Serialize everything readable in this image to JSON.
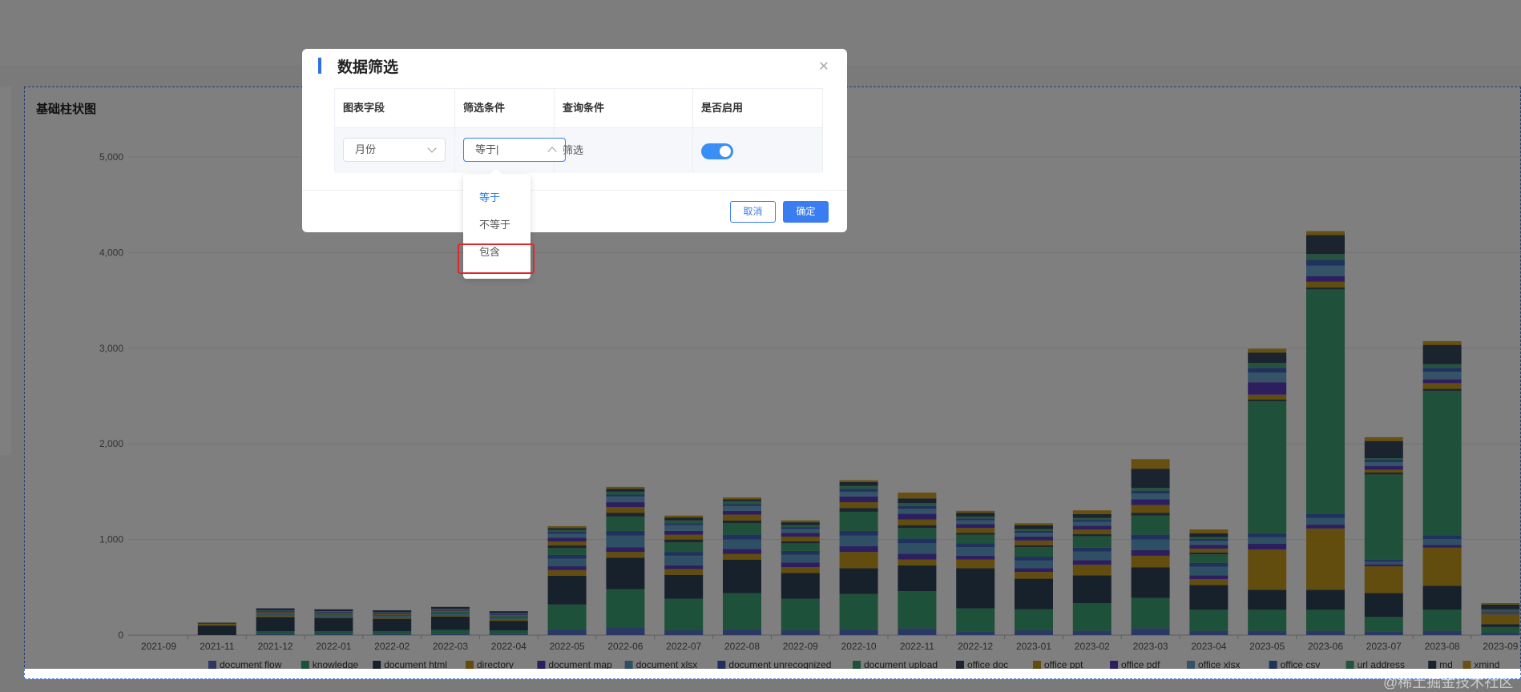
{
  "card": {
    "title": "基础柱状图"
  },
  "modal": {
    "title": "数据筛选",
    "headers": [
      "图表字段",
      "筛选条件",
      "查询条件",
      "是否启用"
    ],
    "row": {
      "field": "月份",
      "condition": "等于|",
      "query": "筛选",
      "enabled": true
    },
    "cancel_label": "取消",
    "ok_label": "确定"
  },
  "dropdown": {
    "options": [
      "等于",
      "不等于",
      "包含"
    ],
    "selected": "等于"
  },
  "watermark": "@稀土掘金技术社区",
  "colors": {
    "document_flow": "#5470c6",
    "knowledge": "#3ba272",
    "document_html": "#2f4258",
    "directory": "#c49a1f",
    "document_map": "#5b3fbf",
    "document_xlsx": "#5f9fc9",
    "document_unrecognized": "#3e63b8",
    "document_upload": "#3fa073",
    "office_doc": "#3b4a5e",
    "office_ppt": "#c49a1f",
    "office_pdf": "#5b3fbf",
    "office_xlsx": "#6aa6cf",
    "office_csv": "#3e63b8",
    "url_address": "#4aa67f",
    "md": "#34475c",
    "xmind": "#d0a020"
  },
  "chart_data": {
    "type": "bar",
    "stacked": true,
    "ylim": [
      0,
      5000
    ],
    "yticks": [
      "0",
      "1,000",
      "2,000",
      "3,000",
      "4,000",
      "5,000"
    ],
    "categories": [
      "2021-09",
      "2021-11",
      "2021-12",
      "2022-01",
      "2022-02",
      "2022-03",
      "2022-04",
      "2022-05",
      "2022-06",
      "2022-07",
      "2022-08",
      "2022-09",
      "2022-10",
      "2022-11",
      "2022-12",
      "2023-01",
      "2023-02",
      "2023-03",
      "2023-04",
      "2023-05",
      "2023-06",
      "2023-07",
      "2023-08",
      "2023-09"
    ],
    "series": [
      {
        "name": "document_flow",
        "values": [
          0,
          0,
          10,
          10,
          10,
          15,
          10,
          60,
          80,
          50,
          60,
          50,
          60,
          70,
          40,
          50,
          45,
          70,
          45,
          45,
          45,
          40,
          45,
          25
        ]
      },
      {
        "name": "knowledge",
        "values": [
          0,
          0,
          30,
          30,
          30,
          40,
          40,
          260,
          400,
          330,
          380,
          330,
          370,
          390,
          240,
          220,
          290,
          320,
          220,
          220,
          220,
          150,
          220,
          60
        ]
      },
      {
        "name": "document_html",
        "values": [
          0,
          100,
          150,
          140,
          130,
          140,
          100,
          300,
          330,
          250,
          350,
          270,
          270,
          270,
          420,
          320,
          290,
          320,
          260,
          210,
          210,
          250,
          250,
          30
        ]
      },
      {
        "name": "directory",
        "values": [
          0,
          10,
          10,
          10,
          10,
          10,
          10,
          60,
          60,
          60,
          60,
          60,
          170,
          60,
          90,
          70,
          110,
          120,
          60,
          420,
          640,
          280,
          400,
          100
        ]
      },
      {
        "name": "document_map",
        "values": [
          0,
          0,
          0,
          0,
          0,
          0,
          0,
          40,
          50,
          40,
          50,
          50,
          60,
          60,
          40,
          40,
          50,
          60,
          40,
          60,
          40,
          20,
          30,
          5
        ]
      },
      {
        "name": "document_xlsx",
        "values": [
          0,
          0,
          20,
          20,
          20,
          20,
          20,
          80,
          120,
          100,
          100,
          80,
          110,
          110,
          90,
          80,
          90,
          110,
          90,
          70,
          70,
          30,
          60,
          5
        ]
      },
      {
        "name": "document_unrecognized",
        "values": [
          0,
          0,
          0,
          0,
          0,
          0,
          0,
          40,
          50,
          40,
          50,
          40,
          50,
          50,
          40,
          40,
          40,
          50,
          40,
          40,
          40,
          20,
          40,
          5
        ]
      },
      {
        "name": "document_upload",
        "values": [
          0,
          0,
          10,
          10,
          10,
          20,
          20,
          70,
          150,
          100,
          120,
          80,
          200,
          110,
          90,
          100,
          120,
          200,
          90,
          1380,
          2350,
          890,
          1510,
          5
        ]
      },
      {
        "name": "office_doc",
        "values": [
          0,
          0,
          0,
          0,
          0,
          0,
          0,
          30,
          40,
          30,
          30,
          20,
          40,
          30,
          20,
          20,
          20,
          30,
          20,
          20,
          20,
          20,
          20,
          5
        ]
      },
      {
        "name": "office_ppt",
        "values": [
          0,
          10,
          10,
          10,
          10,
          10,
          10,
          40,
          60,
          50,
          60,
          50,
          60,
          60,
          50,
          50,
          50,
          80,
          40,
          50,
          60,
          30,
          60,
          5
        ]
      },
      {
        "name": "office_pdf",
        "values": [
          0,
          0,
          10,
          10,
          10,
          10,
          10,
          40,
          50,
          40,
          40,
          40,
          60,
          60,
          40,
          40,
          40,
          60,
          40,
          130,
          60,
          40,
          40,
          5
        ]
      },
      {
        "name": "office_xlsx",
        "values": [
          0,
          0,
          10,
          10,
          10,
          10,
          10,
          40,
          60,
          60,
          50,
          40,
          50,
          50,
          40,
          40,
          40,
          60,
          40,
          100,
          110,
          40,
          80,
          10
        ]
      },
      {
        "name": "office_csv",
        "values": [
          0,
          0,
          0,
          0,
          0,
          0,
          0,
          20,
          20,
          20,
          20,
          20,
          30,
          30,
          20,
          20,
          20,
          30,
          20,
          50,
          60,
          20,
          40,
          5
        ]
      },
      {
        "name": "url_address",
        "values": [
          0,
          0,
          0,
          0,
          0,
          0,
          0,
          20,
          30,
          30,
          30,
          20,
          30,
          30,
          20,
          20,
          20,
          30,
          20,
          50,
          60,
          20,
          40,
          5
        ]
      },
      {
        "name": "md",
        "values": [
          0,
          10,
          20,
          20,
          20,
          20,
          20,
          20,
          30,
          30,
          20,
          30,
          40,
          50,
          40,
          40,
          40,
          200,
          40,
          110,
          200,
          180,
          200,
          50
        ]
      },
      {
        "name": "xmind",
        "values": [
          0,
          0,
          0,
          0,
          0,
          0,
          0,
          20,
          20,
          20,
          20,
          20,
          20,
          60,
          20,
          20,
          40,
          100,
          40,
          40,
          40,
          40,
          40,
          15
        ]
      }
    ]
  }
}
